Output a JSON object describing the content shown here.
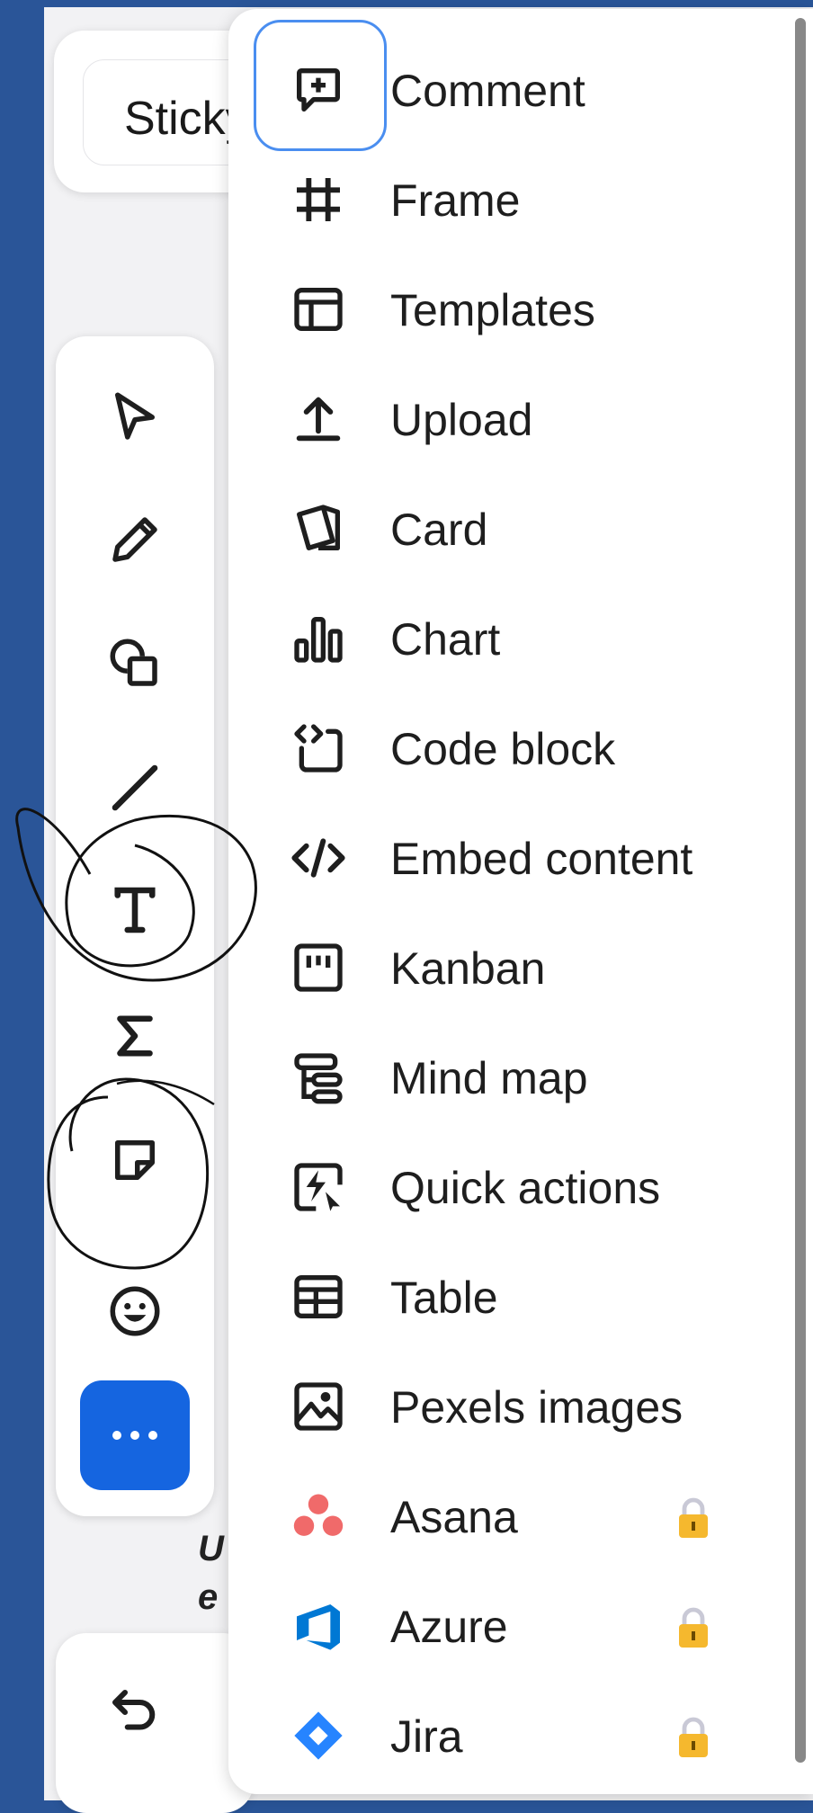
{
  "topbar": {
    "sticky_label": "Sticky"
  },
  "toolbar": {
    "tools": [
      {
        "name": "select",
        "icon": "cursor-icon"
      },
      {
        "name": "pen",
        "icon": "pen-icon"
      },
      {
        "name": "shapes",
        "icon": "shapes-icon"
      },
      {
        "name": "line",
        "icon": "line-icon"
      },
      {
        "name": "text",
        "icon": "text-icon"
      },
      {
        "name": "formula",
        "icon": "sigma-icon"
      },
      {
        "name": "sticky-note",
        "icon": "sticky-note-icon"
      },
      {
        "name": "emoji",
        "icon": "emoji-icon"
      }
    ],
    "more_label": "⋯"
  },
  "canvas_text": {
    "line1": "U",
    "line2": "e"
  },
  "menu": {
    "items": [
      {
        "label": "Comment",
        "icon": "comment-plus-icon"
      },
      {
        "label": "Frame",
        "icon": "frame-icon"
      },
      {
        "label": "Templates",
        "icon": "templates-icon"
      },
      {
        "label": "Upload",
        "icon": "upload-icon"
      },
      {
        "label": "Card",
        "icon": "card-icon"
      },
      {
        "label": "Chart",
        "icon": "chart-icon"
      },
      {
        "label": "Code block",
        "icon": "code-block-icon"
      },
      {
        "label": "Embed content",
        "icon": "embed-icon"
      },
      {
        "label": "Kanban",
        "icon": "kanban-icon"
      },
      {
        "label": "Mind map",
        "icon": "mind-map-icon"
      },
      {
        "label": "Quick actions",
        "icon": "quick-actions-icon"
      },
      {
        "label": "Table",
        "icon": "table-icon"
      },
      {
        "label": "Pexels images",
        "icon": "image-icon"
      },
      {
        "label": "Asana",
        "icon": "asana-icon",
        "locked": true
      },
      {
        "label": "Azure",
        "icon": "azure-icon",
        "locked": true
      },
      {
        "label": "Jira",
        "icon": "jira-icon",
        "locked": true
      }
    ]
  },
  "colors": {
    "background": "#2a5598",
    "accent": "#1565e0",
    "focus": "#4a8ef0",
    "lock": "#f5b82e",
    "asana": "#f06a6a",
    "azure": "#0078d4",
    "jira": "#2684ff"
  }
}
